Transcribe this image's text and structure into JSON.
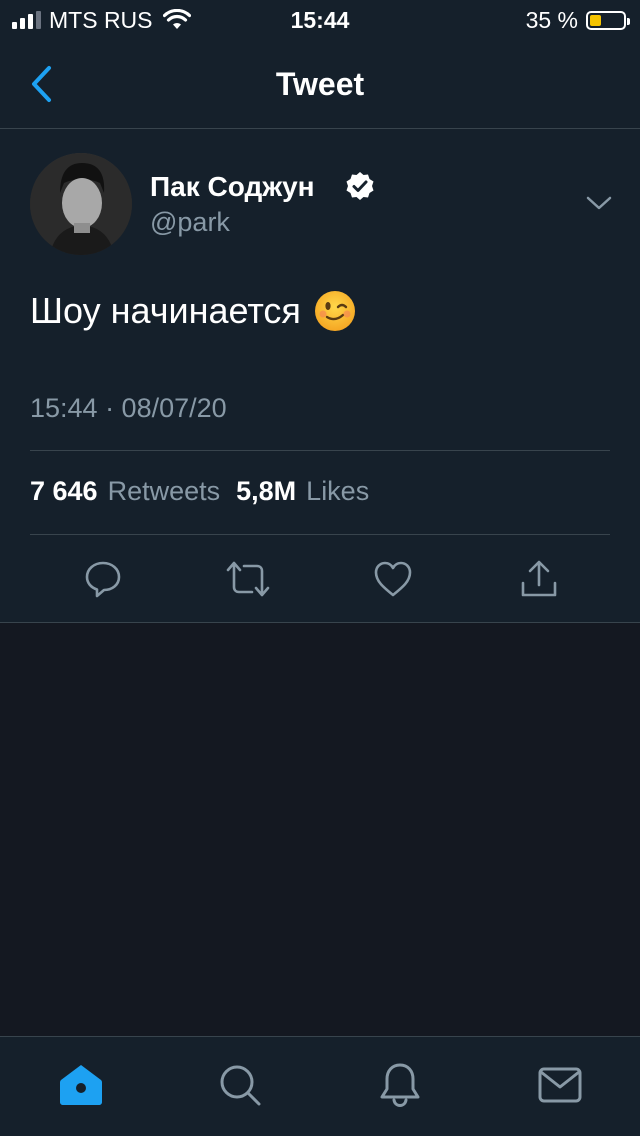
{
  "status_bar": {
    "carrier": "MTS RUS",
    "time": "15:44",
    "battery_percent": "35 %",
    "battery_level": 0.35,
    "signal_bars_filled": 3,
    "signal_bars_total": 4,
    "wifi_icon": "wifi-icon"
  },
  "nav": {
    "title": "Tweet",
    "back_icon": "chevron-left-icon"
  },
  "tweet": {
    "display_name": "Пак Соджун",
    "handle": "@park",
    "verified": true,
    "text": "Шоу начинается",
    "emoji_icon": "winking-face-emoji",
    "timestamp": "15:44 · 08/07/20",
    "retweets_count": "7 646",
    "retweets_label": "Retweets",
    "likes_count": "5,8M",
    "likes_label": "Likes",
    "actions": [
      "reply-icon",
      "retweet-icon",
      "like-icon",
      "share-icon"
    ]
  },
  "tabbar": {
    "tabs": [
      "home-icon",
      "search-icon",
      "notifications-icon",
      "messages-icon"
    ],
    "active": "home-icon"
  },
  "colors": {
    "accent": "#1da1f2",
    "background": "#15202b",
    "empty_area": "#141821",
    "secondary_text": "#8899a6",
    "divider": "#38444d",
    "battery_fill": "#f5c400"
  }
}
